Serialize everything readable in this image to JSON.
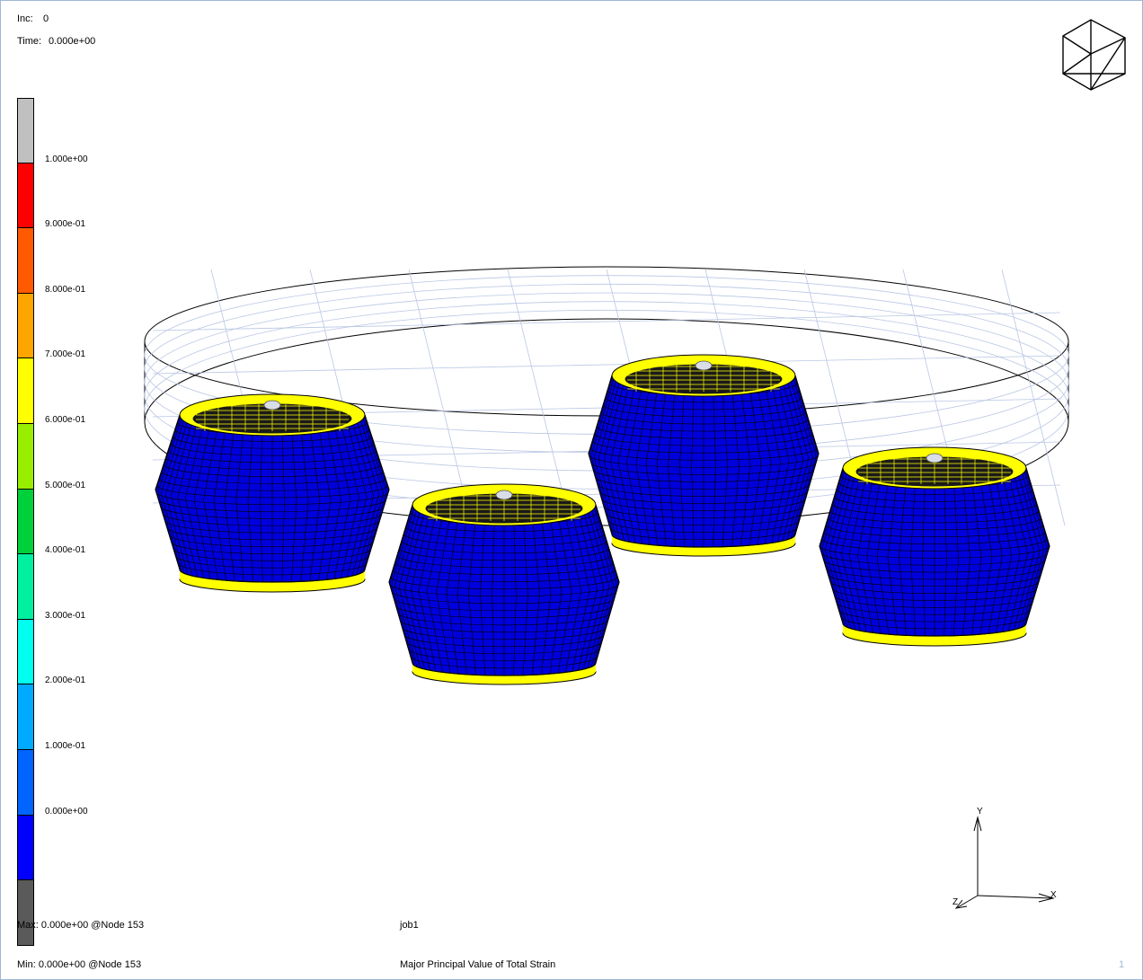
{
  "header": {
    "inc_label": "Inc:",
    "inc_value": "0",
    "time_label": "Time:",
    "time_value": "0.000e+00"
  },
  "legend": {
    "colors": [
      "#c0c0c0",
      "#ff0000",
      "#ff5a00",
      "#ffa500",
      "#ffff00",
      "#99ee00",
      "#00d03a",
      "#00f0a0",
      "#00ffee",
      "#00aaff",
      "#0064ff",
      "#0000ff",
      "#5a5a5a"
    ],
    "labels": [
      "1.000e+00",
      "9.000e-01",
      "8.000e-01",
      "7.000e-01",
      "6.000e-01",
      "5.000e-01",
      "4.000e-01",
      "3.000e-01",
      "2.000e-01",
      "1.000e-01",
      "0.000e+00"
    ]
  },
  "footer": {
    "max_text": "Max:  0.000e+00 @Node   153",
    "min_text": "Min:  0.000e+00 @Node   153",
    "job_name": "job1",
    "result_name": "Major Principal Value of Total Strain",
    "page_number": "1"
  },
  "axes": {
    "x": "X",
    "y": "Y",
    "z": "Z"
  },
  "model": {
    "body_color": "#0000dd",
    "ring_color": "#ffff00"
  }
}
